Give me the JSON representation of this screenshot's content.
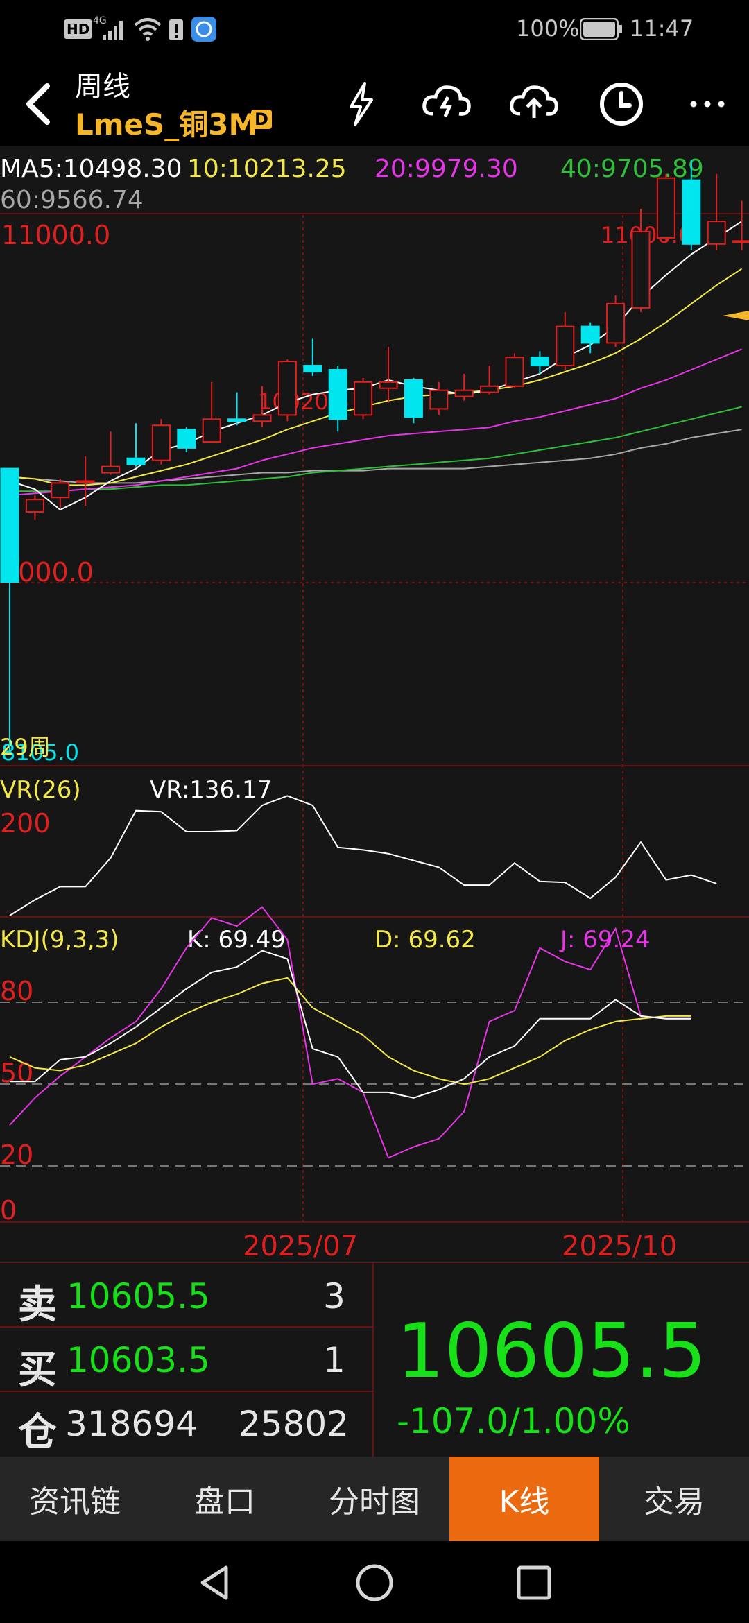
{
  "status_bar": {
    "network": "HD",
    "signal_label": "4G",
    "battery": "100%",
    "time": "11:47"
  },
  "header": {
    "period": "周线",
    "symbol": "LmeS_铜3M",
    "badge": "D"
  },
  "indicators": {
    "ma5": "MA5:10498.30",
    "ma10": "10:10213.25",
    "ma20": "20:9979.30",
    "ma40": "40:9705.89",
    "ma60": "60:9566.74"
  },
  "price_panel": {
    "top_label": "11000.0",
    "mid_label": "9000.0",
    "bottom_label": "8105.0",
    "week_label": "29周",
    "high_annotation": "11000.0",
    "mid_annotation": "10020.5"
  },
  "vr_panel": {
    "title": "VR(26)",
    "value": "VR:136.17",
    "level": "200"
  },
  "kdj_panel": {
    "title": "KDJ(9,3,3)",
    "k": "K: 69.49",
    "d": "D: 69.62",
    "j": "J: 69.24",
    "l80": "80",
    "l50": "50",
    "l20": "20",
    "l0": "0"
  },
  "dates": [
    "2025/07",
    "2025/10"
  ],
  "quote": {
    "sell_label": "卖",
    "sell_price": "10605.5",
    "sell_qty": "3",
    "buy_label": "买",
    "buy_price": "10603.5",
    "buy_qty": "1",
    "oi_label": "仓",
    "oi_value": "318694",
    "oi_change": "25802",
    "last_price": "10605.5",
    "change": "-107.0/1.00%"
  },
  "tabs": [
    "资讯链",
    "盘口",
    "分时图",
    "K线",
    "交易"
  ],
  "active_tab": "K线",
  "colors": {
    "up": "#e0201f",
    "down": "#00e5ee",
    "ma5": "#ffffff",
    "ma10": "#f2e84a",
    "ma20": "#e635e6",
    "ma40": "#2fbf3a",
    "ma60": "#a8a8a8",
    "accent": "#ec6a0f",
    "price_green": "#18e018"
  },
  "chart_data": {
    "type": "candlestick",
    "ylim": [
      8105,
      11000
    ],
    "candles": [
      {
        "o": 9500,
        "c": 8950,
        "h": 9500,
        "l": 8130
      },
      {
        "o": 9290,
        "c": 9350,
        "h": 9370,
        "l": 9250
      },
      {
        "o": 9360,
        "c": 9430,
        "h": 9450,
        "l": 9310
      },
      {
        "o": 9440,
        "c": 9440,
        "h": 9560,
        "l": 9320
      },
      {
        "o": 9480,
        "c": 9510,
        "h": 9680,
        "l": 9470
      },
      {
        "o": 9550,
        "c": 9520,
        "h": 9720,
        "l": 9510
      },
      {
        "o": 9540,
        "c": 9710,
        "h": 9740,
        "l": 9520
      },
      {
        "o": 9690,
        "c": 9600,
        "h": 9700,
        "l": 9580
      },
      {
        "o": 9630,
        "c": 9740,
        "h": 9920,
        "l": 9630
      },
      {
        "o": 9740,
        "c": 9730,
        "h": 9870,
        "l": 9710
      },
      {
        "o": 9730,
        "c": 9760,
        "h": 9900,
        "l": 9700
      },
      {
        "o": 9760,
        "c": 10020,
        "h": 10030,
        "l": 9730
      },
      {
        "o": 10000,
        "c": 9970,
        "h": 10130,
        "l": 9950
      },
      {
        "o": 9980,
        "c": 9740,
        "h": 10000,
        "l": 9680
      },
      {
        "o": 9760,
        "c": 9920,
        "h": 9940,
        "l": 9740
      },
      {
        "o": 9890,
        "c": 9920,
        "h": 10090,
        "l": 9820
      },
      {
        "o": 9930,
        "c": 9750,
        "h": 9940,
        "l": 9720
      },
      {
        "o": 9790,
        "c": 9880,
        "h": 9920,
        "l": 9760
      },
      {
        "o": 9850,
        "c": 9880,
        "h": 9960,
        "l": 9830
      },
      {
        "o": 9870,
        "c": 9900,
        "h": 10000,
        "l": 9860
      },
      {
        "o": 9900,
        "c": 10040,
        "h": 10060,
        "l": 9890
      },
      {
        "o": 10040,
        "c": 10000,
        "h": 10070,
        "l": 9960
      },
      {
        "o": 10000,
        "c": 10190,
        "h": 10260,
        "l": 9980
      },
      {
        "o": 10190,
        "c": 10110,
        "h": 10210,
        "l": 10060
      },
      {
        "o": 10110,
        "c": 10300,
        "h": 10340,
        "l": 10090
      },
      {
        "o": 10280,
        "c": 10650,
        "h": 10760,
        "l": 10260
      },
      {
        "o": 10620,
        "c": 10910,
        "h": 10930,
        "l": 10600
      },
      {
        "o": 10900,
        "c": 10590,
        "h": 11000,
        "l": 10560
      },
      {
        "o": 10590,
        "c": 10700,
        "h": 10930,
        "l": 10560
      },
      {
        "o": 10605,
        "c": 10605,
        "h": 10800,
        "l": 10560
      }
    ],
    "ma5": [
      9440,
      9400,
      9300,
      9360,
      9440,
      9500,
      9590,
      9620,
      9680,
      9720,
      9760,
      9820,
      9860,
      9880,
      9890,
      9930,
      9900,
      9880,
      9860,
      9880,
      9920,
      9960,
      10040,
      10100,
      10190,
      10330,
      10440,
      10540,
      10620,
      10700
    ],
    "ma10": [
      9460,
      9450,
      9420,
      9420,
      9430,
      9460,
      9490,
      9520,
      9560,
      9600,
      9640,
      9690,
      9730,
      9770,
      9800,
      9830,
      9850,
      9860,
      9870,
      9880,
      9900,
      9930,
      9970,
      10010,
      10060,
      10130,
      10210,
      10300,
      10390,
      10470
    ],
    "ma20": [
      9370,
      9380,
      9390,
      9400,
      9410,
      9420,
      9440,
      9460,
      9480,
      9500,
      9540,
      9570,
      9600,
      9620,
      9640,
      9660,
      9670,
      9680,
      9690,
      9700,
      9730,
      9750,
      9780,
      9810,
      9840,
      9890,
      9930,
      9980,
      10030,
      10080
    ],
    "ma40": [
      9390,
      9390,
      9390,
      9400,
      9400,
      9410,
      9420,
      9420,
      9430,
      9440,
      9450,
      9460,
      9480,
      9490,
      9500,
      9510,
      9520,
      9530,
      9540,
      9550,
      9570,
      9590,
      9610,
      9630,
      9650,
      9680,
      9710,
      9740,
      9770,
      9800
    ],
    "ma60": [
      9460,
      9450,
      9440,
      9430,
      9430,
      9430,
      9440,
      9450,
      9460,
      9470,
      9480,
      9480,
      9490,
      9490,
      9490,
      9500,
      9500,
      9500,
      9500,
      9510,
      9520,
      9530,
      9540,
      9550,
      9570,
      9600,
      9620,
      9650,
      9670,
      9690
    ],
    "vr": [
      50,
      80,
      105,
      105,
      160,
      250,
      248,
      210,
      210,
      212,
      260,
      278,
      260,
      180,
      175,
      168,
      155,
      142,
      108,
      108,
      150,
      115,
      113,
      83,
      123,
      190,
      118,
      127,
      111
    ],
    "vr_ylim": [
      50,
      280
    ],
    "kdj_ylim": [
      0,
      100
    ],
    "k": [
      46,
      46,
      54,
      55,
      60,
      66,
      73,
      80,
      86,
      88,
      94,
      91,
      58,
      55,
      42,
      42,
      40,
      43,
      47,
      55,
      59,
      69,
      69,
      69,
      76,
      70,
      69,
      69
    ],
    "d": [
      55,
      51,
      50,
      52,
      56,
      60,
      66,
      71,
      75,
      78,
      82,
      84,
      73,
      68,
      63,
      55,
      50,
      47,
      45,
      47,
      51,
      55,
      61,
      65,
      68,
      69,
      70,
      70
    ],
    "j": [
      30,
      40,
      48,
      55,
      62,
      68,
      80,
      95,
      106,
      103,
      110,
      98,
      45,
      47,
      42,
      18,
      22,
      25,
      35,
      68,
      72,
      95,
      90,
      87,
      102,
      70,
      69,
      69
    ]
  }
}
